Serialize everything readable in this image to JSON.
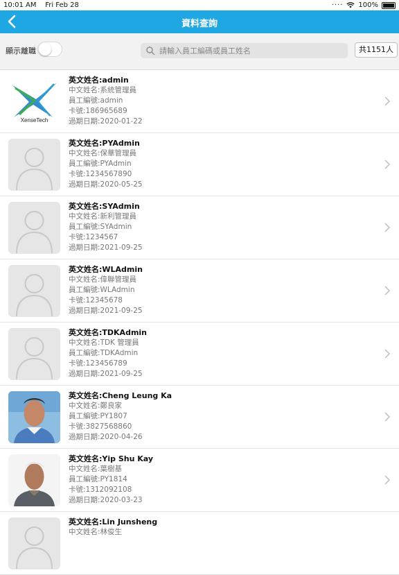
{
  "status_bar": {
    "time": "10:01 AM",
    "date": "Fri Feb 28",
    "battery": "100%"
  },
  "nav": {
    "title": "資料查詢"
  },
  "toolbar": {
    "toggle_label": "顯示離職",
    "toggle_on": false,
    "search_placeholder": "請輸入員工編碼或員工姓名",
    "search_value": "",
    "count_label": "共1151人"
  },
  "logo": {
    "text": "XenseTech"
  },
  "employees": [
    {
      "en_name": "英文姓名:admin",
      "zh_name": "中文姓名:系統管理員",
      "emp_no": "員工編號:admin",
      "card_no": "卡號:186965689",
      "expiry": "過期日期:2020-01-22",
      "avatar": "logo"
    },
    {
      "en_name": "英文姓名:PYAdmin",
      "zh_name": "中文姓名:保華管理員",
      "emp_no": "員工編號:PYAdmin",
      "card_no": "卡號:1234567890",
      "expiry": "過期日期:2020-05-25",
      "avatar": "placeholder"
    },
    {
      "en_name": "英文姓名:SYAdmin",
      "zh_name": "中文姓名:新利管理員",
      "emp_no": "員工編號:SYAdmin",
      "card_no": "卡號:1234567",
      "expiry": "過期日期:2021-09-25",
      "avatar": "placeholder"
    },
    {
      "en_name": "英文姓名:WLAdmin",
      "zh_name": "中文姓名:偉聯管理員",
      "emp_no": "員工編號:WLAdmin",
      "card_no": "卡號:12345678",
      "expiry": "過期日期:2021-09-25",
      "avatar": "placeholder"
    },
    {
      "en_name": "英文姓名:TDKAdmin",
      "zh_name": "中文姓名:TDK 管理員",
      "emp_no": "員工編號:TDKAdmin",
      "card_no": "卡號:123456789",
      "expiry": "過期日期:2021-09-25",
      "avatar": "placeholder"
    },
    {
      "en_name": "英文姓名:Cheng Leung Ka",
      "zh_name": "中文姓名:鄭良家",
      "emp_no": "員工編號:PY1807",
      "card_no": "卡號:3827568860",
      "expiry": "過期日期:2020-04-26",
      "avatar": "photo-1"
    },
    {
      "en_name": "英文姓名:Yip Shu Kay",
      "zh_name": "中文姓名:葉樹基",
      "emp_no": "員工編號:PY1814",
      "card_no": "卡號:1312092108",
      "expiry": "過期日期:2020-03-23",
      "avatar": "photo-2"
    },
    {
      "en_name": "英文姓名:Lin Junsheng",
      "zh_name": "中文姓名:林俊生",
      "emp_no": "",
      "card_no": "",
      "expiry": "",
      "avatar": "placeholder"
    }
  ],
  "colors": {
    "nav_bg": "#1fa7e3",
    "toolbar_bg": "#f2f2f2",
    "logo_blue": "#1e7fc6",
    "logo_green": "#3cb04a"
  }
}
